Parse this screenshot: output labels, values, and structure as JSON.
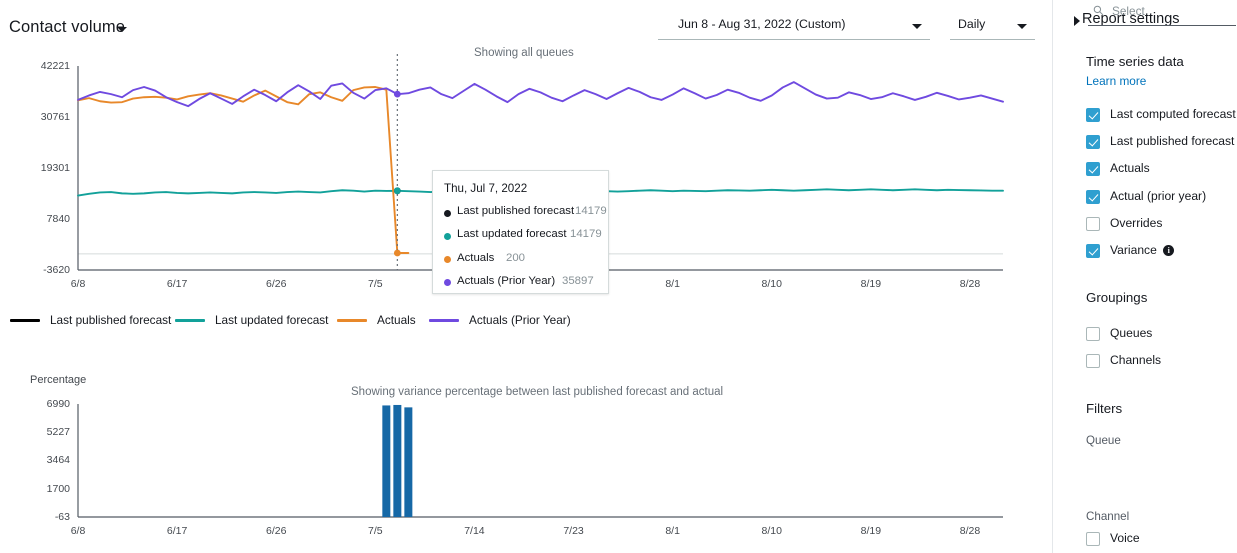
{
  "header": {
    "title": "Contact volume",
    "title_caret_icon": "chevron-down-icon",
    "date_range": "Jun 8 - Aug 31, 2022 (Custom)",
    "granularity": "Daily"
  },
  "line_chart": {
    "caption": "Showing all queues"
  },
  "legend": [
    {
      "label": "Last published forecast",
      "color": "#000000",
      "x": 10
    },
    {
      "label": "Last updated forecast",
      "color": "#12a19a",
      "x": 175
    },
    {
      "label": "Actuals",
      "color": "#e8882a",
      "x": 337
    },
    {
      "label": "Actuals (Prior Year)",
      "color": "#6f4ae0",
      "x": 429
    }
  ],
  "tooltip": {
    "date": "Thu, Jul 7, 2022",
    "rows": [
      {
        "label": "Last published forecast",
        "value": "14179",
        "color": "#16191f",
        "value_x": 131
      },
      {
        "label": "Last updated forecast",
        "value": "14179",
        "color": "#12a19a",
        "value_x": 126
      },
      {
        "label": "Actuals",
        "value": "200",
        "color": "#e8882a",
        "value_x": 62
      },
      {
        "label": "Actuals (Prior Year)",
        "value": "35897",
        "color": "#6f4ae0",
        "value_x": 118
      }
    ]
  },
  "bar_chart": {
    "y_axis_title": "Percentage",
    "caption": "Showing variance percentage between last published forecast and actual"
  },
  "sidebar": {
    "header": "Report settings",
    "chevron_icon": "chevron-right-icon",
    "time_series_title": "Time series data",
    "learn_more": "Learn more",
    "time_series_items": [
      {
        "label": "Last computed forecast",
        "checked": true
      },
      {
        "label": "Last published forecast",
        "checked": true
      },
      {
        "label": "Actuals",
        "checked": true
      },
      {
        "label": "Actual (prior year)",
        "checked": true
      },
      {
        "label": "Overrides",
        "checked": false
      },
      {
        "label": "Variance",
        "checked": true,
        "info": "i"
      }
    ],
    "groupings_title": "Groupings",
    "groupings_items": [
      {
        "label": "Queues",
        "checked": false
      },
      {
        "label": "Channels",
        "checked": false
      }
    ],
    "filters_title": "Filters",
    "queue_label": "Queue",
    "queue_placeholder": "Select",
    "queue_search_icon": "search-icon",
    "channel_label": "Channel",
    "channel_items": [
      {
        "label": "Voice",
        "checked": false
      }
    ]
  },
  "chart_data": [
    {
      "type": "line",
      "title": "Contact volume",
      "subtitle": "Showing all queues",
      "xlabel": "",
      "ylabel": "",
      "ylim": [
        -3620,
        42221
      ],
      "yticks": [
        42221,
        30761,
        19301,
        7840,
        -3620
      ],
      "xticks": [
        "6/8",
        "6/17",
        "6/26",
        "7/5",
        "7/14",
        "7/23",
        "8/1",
        "8/10",
        "8/19",
        "8/28"
      ],
      "x": [
        "6/8",
        "6/9",
        "6/10",
        "6/11",
        "6/12",
        "6/13",
        "6/14",
        "6/15",
        "6/16",
        "6/17",
        "6/18",
        "6/19",
        "6/20",
        "6/21",
        "6/22",
        "6/23",
        "6/24",
        "6/25",
        "6/26",
        "6/27",
        "6/28",
        "6/29",
        "6/30",
        "7/1",
        "7/2",
        "7/3",
        "7/4",
        "7/5",
        "7/6",
        "7/7",
        "7/8",
        "7/9",
        "7/10",
        "7/11",
        "7/12",
        "7/13",
        "7/14",
        "7/15",
        "7/16",
        "7/17",
        "7/18",
        "7/19",
        "7/20",
        "7/21",
        "7/22",
        "7/23",
        "7/24",
        "7/25",
        "7/26",
        "7/27",
        "7/28",
        "7/29",
        "7/30",
        "7/31",
        "8/1",
        "8/2",
        "8/3",
        "8/4",
        "8/5",
        "8/6",
        "8/7",
        "8/8",
        "8/9",
        "8/10",
        "8/11",
        "8/12",
        "8/13",
        "8/14",
        "8/15",
        "8/16",
        "8/17",
        "8/18",
        "8/19",
        "8/20",
        "8/21",
        "8/22",
        "8/23",
        "8/24",
        "8/25",
        "8/26",
        "8/27",
        "8/28",
        "8/29",
        "8/30",
        "8/31"
      ],
      "grid": false,
      "legend_position": "bottom",
      "crosshair_x": "7/7",
      "series": [
        {
          "name": "Last published forecast",
          "color": "#000000",
          "values": [
            null,
            null,
            null,
            null,
            null,
            null,
            null,
            null,
            null,
            null,
            null,
            null,
            null,
            null,
            null,
            null,
            null,
            null,
            null,
            null,
            null,
            null,
            null,
            null,
            null,
            null,
            null,
            null,
            null,
            14179,
            null,
            null,
            null,
            null,
            null,
            null,
            null,
            null,
            null,
            null,
            null,
            null,
            null,
            null,
            null,
            null,
            null,
            null,
            null,
            null,
            null,
            null,
            null,
            null,
            null,
            null,
            null,
            null,
            null,
            null,
            null,
            null,
            null,
            null,
            null,
            null,
            null,
            null,
            null,
            null,
            null,
            null,
            null,
            null,
            null,
            null,
            null,
            null,
            null,
            null,
            null,
            null,
            null,
            null,
            null
          ]
        },
        {
          "name": "Last updated forecast",
          "color": "#12a19a",
          "values": [
            13100,
            13500,
            13800,
            13900,
            13600,
            13500,
            13600,
            13800,
            13900,
            13700,
            13600,
            13700,
            13800,
            13700,
            13600,
            13800,
            13900,
            13800,
            13700,
            13900,
            14000,
            13900,
            13800,
            14100,
            14300,
            14200,
            14000,
            14200,
            14150,
            14179,
            14100,
            14000,
            13900,
            14000,
            14100,
            14000,
            13900,
            14050,
            14150,
            14000,
            13900,
            14000,
            14100,
            14200,
            14100,
            14000,
            14100,
            14200,
            14100,
            14000,
            14100,
            14200,
            14300,
            14200,
            14100,
            14200,
            14150,
            14100,
            14200,
            14300,
            14250,
            14200,
            14300,
            14400,
            14300,
            14200,
            14300,
            14400,
            14500,
            14400,
            14300,
            14400,
            14500,
            14400,
            14300,
            14400,
            14500,
            14400,
            14300,
            14400,
            14350,
            14300,
            14250,
            14200,
            14200
          ]
        },
        {
          "name": "Actuals",
          "color": "#e8882a",
          "values": [
            34500,
            35000,
            34300,
            34000,
            34100,
            34900,
            35200,
            35300,
            35100,
            34700,
            35400,
            35800,
            36100,
            35600,
            34900,
            34200,
            35600,
            36700,
            35400,
            34100,
            33600,
            35900,
            36300,
            35200,
            34400,
            36800,
            37400,
            37500,
            36900,
            200,
            200,
            null,
            null,
            null,
            null,
            null,
            null,
            null,
            null,
            null,
            null,
            null,
            null,
            null,
            null,
            null,
            null,
            null,
            null,
            null,
            null,
            null,
            null,
            null,
            null,
            null,
            null,
            null,
            null,
            null,
            null,
            null,
            null,
            null,
            null,
            null,
            null,
            null,
            null,
            null,
            null,
            null,
            null,
            null,
            null,
            null,
            null,
            null,
            null,
            null,
            null,
            null,
            null,
            null,
            null
          ]
        },
        {
          "name": "Actuals (Prior Year)",
          "color": "#6f4ae0",
          "values": [
            34600,
            35600,
            36400,
            35900,
            35200,
            36800,
            37500,
            36700,
            35200,
            34100,
            33200,
            34800,
            36100,
            34900,
            33700,
            35400,
            36900,
            35700,
            34300,
            36300,
            37900,
            36500,
            34800,
            37800,
            38300,
            36200,
            34900,
            36800,
            37200,
            35897,
            36100,
            36900,
            37400,
            35900,
            35000,
            36600,
            38200,
            36900,
            35400,
            34100,
            35900,
            37100,
            36300,
            35100,
            34300,
            35600,
            36800,
            35900,
            34800,
            36100,
            37300,
            36400,
            35200,
            34600,
            35800,
            37200,
            36100,
            34900,
            35700,
            36900,
            36200,
            35100,
            34400,
            35600,
            37400,
            38600,
            37200,
            35800,
            34900,
            35100,
            36300,
            35700,
            34800,
            35200,
            36100,
            35400,
            34600,
            35300,
            36200,
            35500,
            34700,
            35100,
            35600,
            34900,
            34200
          ]
        }
      ]
    },
    {
      "type": "bar",
      "title": "Showing variance percentage between last published forecast and actual",
      "ylabel": "Percentage",
      "ylim": [
        -63,
        6990
      ],
      "yticks": [
        6990,
        5227,
        3464,
        1700,
        -63
      ],
      "xticks": [
        "6/8",
        "6/17",
        "6/26",
        "7/5",
        "7/14",
        "7/23",
        "8/1",
        "8/10",
        "8/19",
        "8/28"
      ],
      "color": "#1668a6",
      "categories": [
        "7/6",
        "7/7",
        "7/8"
      ],
      "values": [
        6900,
        6930,
        6780
      ]
    }
  ]
}
